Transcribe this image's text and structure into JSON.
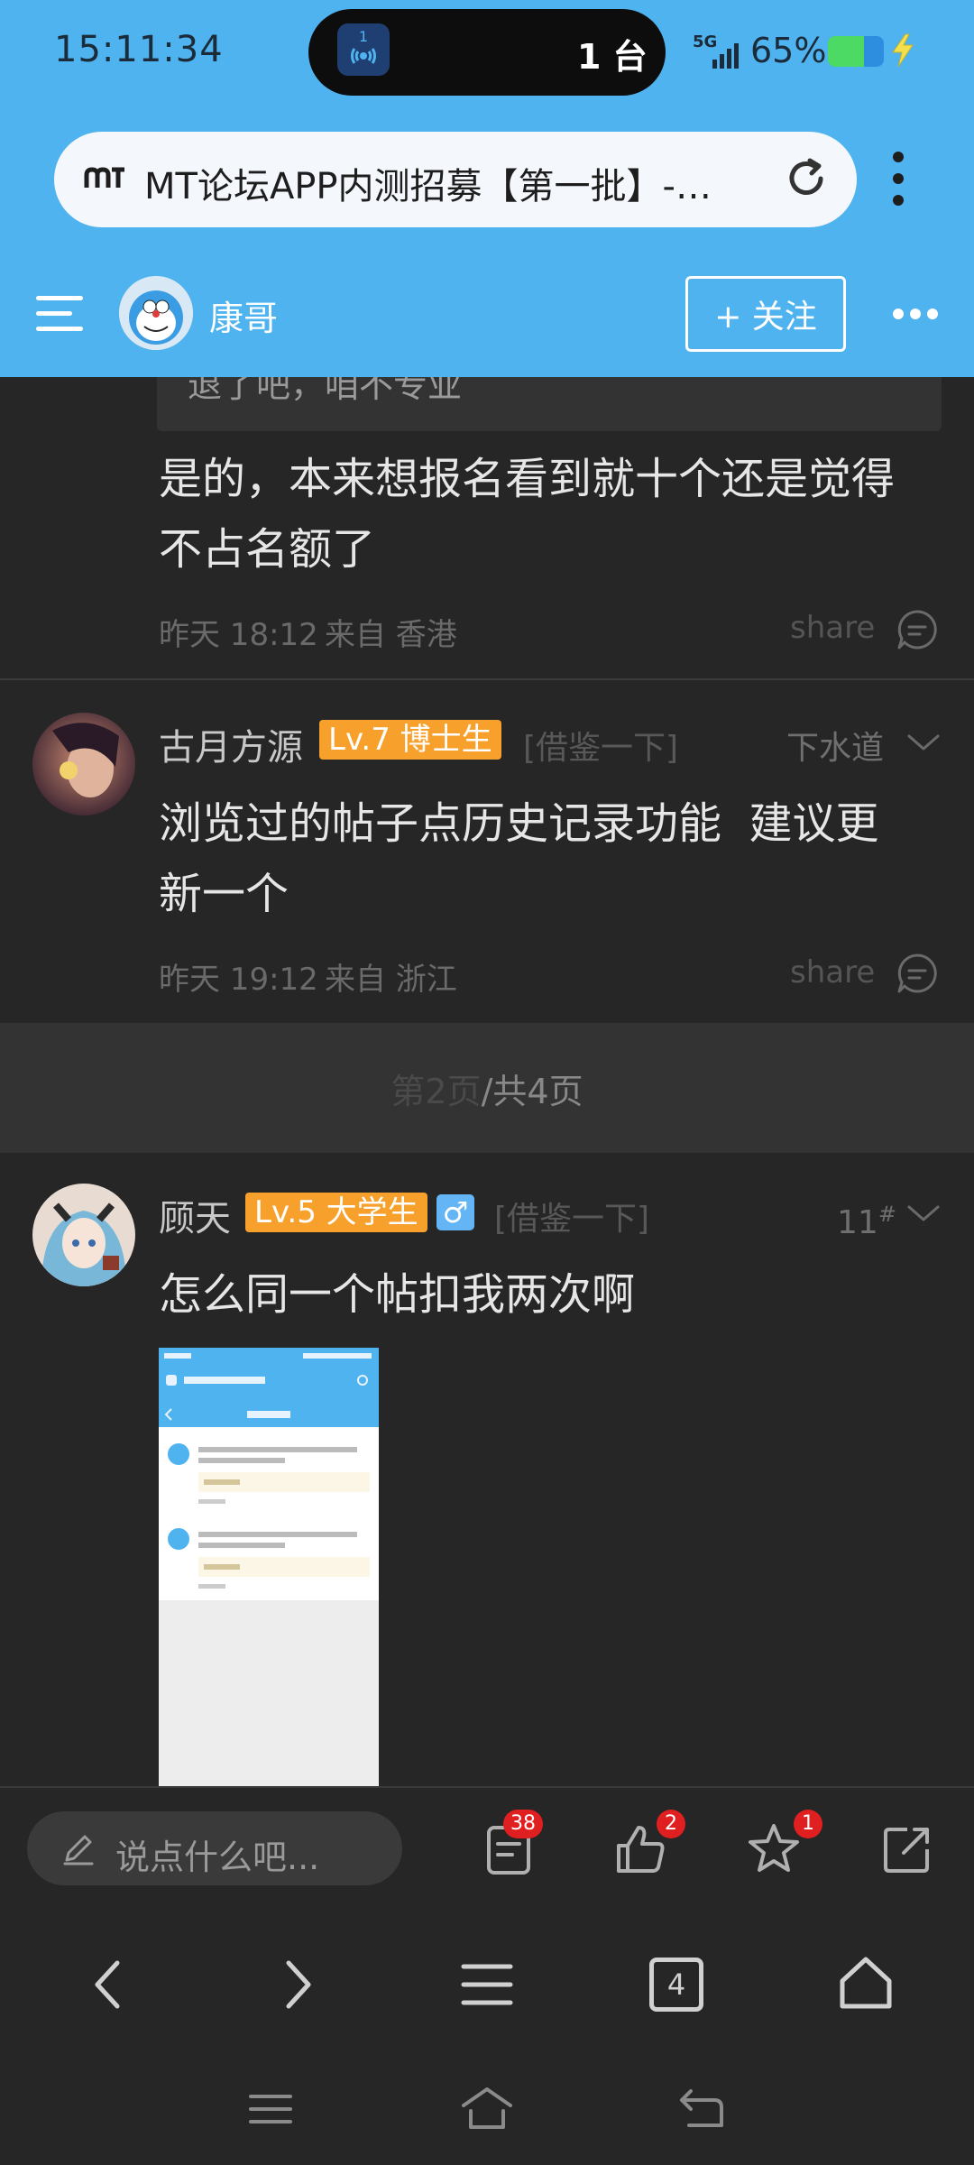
{
  "status_bar": {
    "time": "15:11:34",
    "island_app_badge": "1",
    "island_count": "1 台",
    "network": "5G",
    "battery": "65%",
    "battery_level": 0.65
  },
  "browser": {
    "title": "MT论坛APP内测招募【第一批】-…"
  },
  "thread_header": {
    "author": "康哥",
    "follow_label": "+ 关注"
  },
  "posts": [
    {
      "quote": "退了吧，咱不专业",
      "text_lines": [
        "是的，本来想报名看到就十个还是觉得",
        "不占名额了"
      ],
      "time": "昨天 18:12",
      "from": "来自 香港",
      "share": "share"
    },
    {
      "username": "古月方源",
      "badge": "Lv.7 博士生",
      "tag": "[借鉴一下]",
      "floor": "下水道",
      "text_lines": [
        "浏览过的帖子点历史记录功能  建议更",
        "新一个"
      ],
      "time": "昨天 19:12",
      "from": "来自 浙江",
      "share": "share"
    },
    {
      "username": "顾天",
      "badge": "Lv.5 大学生",
      "gender": "♂",
      "tag": "[借鉴一下]",
      "floor": "11",
      "floor_sup": "#",
      "text_lines": [
        "怎么同一个帖扣我两次啊"
      ]
    }
  ],
  "pager": {
    "current": "第2页",
    "total": "/共4页"
  },
  "toolbar": {
    "placeholder": "说点什么吧...",
    "comments_count": "38",
    "likes_count": "2",
    "favorites_count": "1"
  },
  "browser_nav": {
    "tabs_count": "4"
  },
  "icons": {
    "status": [
      "signal-icon",
      "battery-icon",
      "charging-icon"
    ],
    "browser": [
      "mt-logo-icon",
      "reload-icon",
      "menu-dots-icon"
    ],
    "header": [
      "hamburger-icon",
      "more-dots-icon"
    ],
    "posts": [
      "comment-bubble-icon",
      "chevron-down-icon"
    ],
    "toolbar": [
      "edit-icon",
      "comments-icon",
      "like-icon",
      "star-icon",
      "share-out-icon"
    ],
    "nav": [
      "back-icon",
      "forward-icon",
      "menu-icon",
      "tabs-icon",
      "home-icon"
    ],
    "system": [
      "recents-icon",
      "system-home-icon",
      "system-back-icon"
    ]
  },
  "colors": {
    "header_blue": "#4fb3ef",
    "badge_orange": "#f7a02c",
    "badge_red": "#e02020",
    "background": "#262626"
  }
}
